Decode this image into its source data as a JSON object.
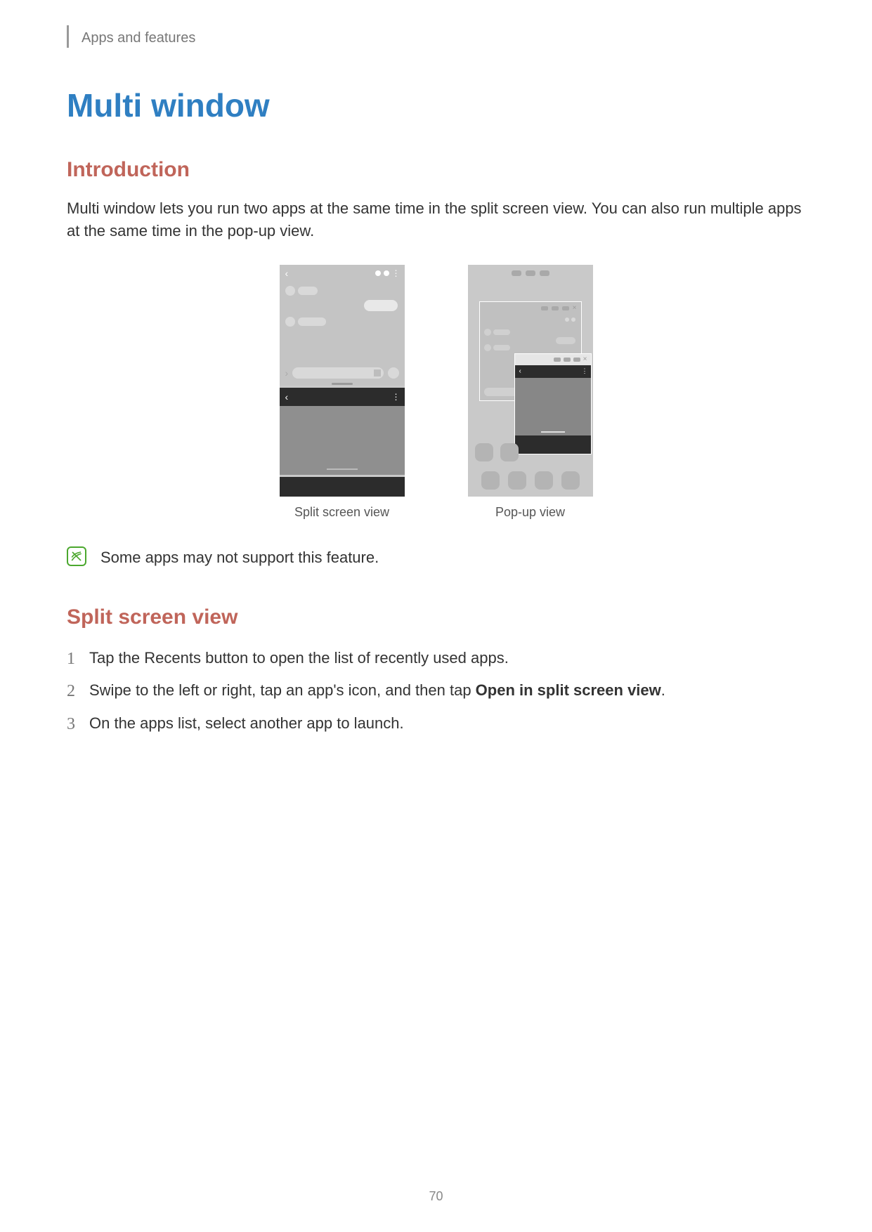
{
  "breadcrumb": "Apps and features",
  "title": "Multi window",
  "section_intro": {
    "heading": "Introduction",
    "paragraph": "Multi window lets you run two apps at the same time in the split screen view. You can also run multiple apps at the same time in the pop-up view."
  },
  "captions": {
    "split": "Split screen view",
    "popup": "Pop-up view"
  },
  "note_text": "Some apps may not support this feature.",
  "section_split": {
    "heading": "Split screen view",
    "steps": [
      {
        "num": "1",
        "text_before": "Tap the Recents button to open the list of recently used apps.",
        "bold": "",
        "text_after": ""
      },
      {
        "num": "2",
        "text_before": "Swipe to the left or right, tap an app's icon, and then tap ",
        "bold": "Open in split screen view",
        "text_after": "."
      },
      {
        "num": "3",
        "text_before": "On the apps list, select another app to launch.",
        "bold": "",
        "text_after": ""
      }
    ]
  },
  "page_number": "70"
}
